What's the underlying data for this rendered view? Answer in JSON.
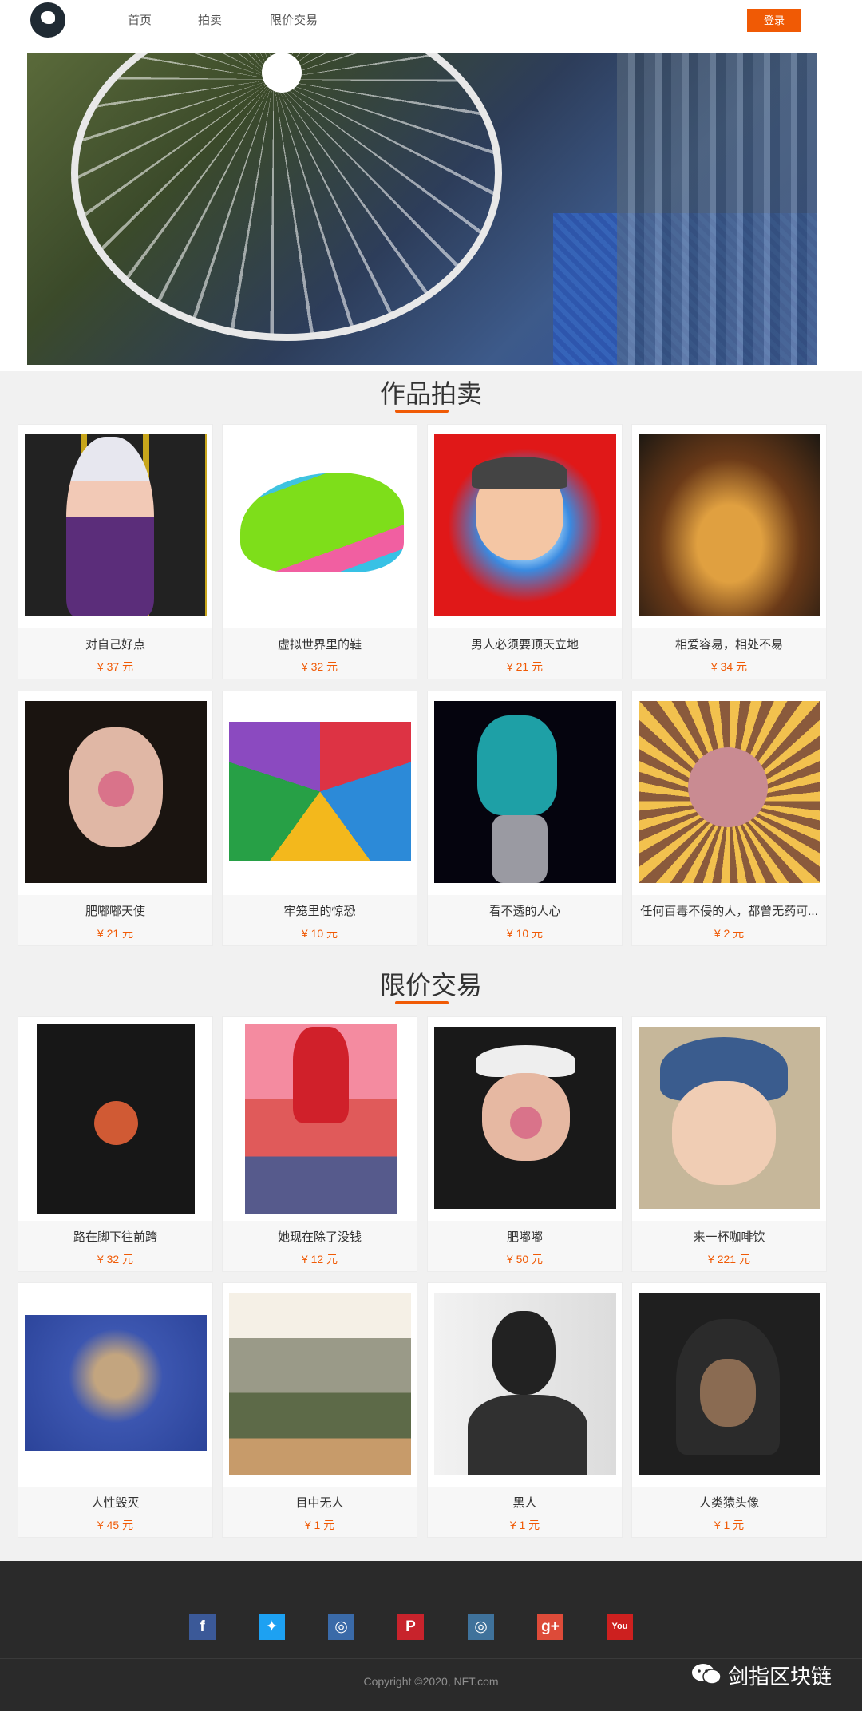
{
  "header": {
    "nav": [
      "首页",
      "拍卖",
      "限价交易"
    ],
    "login_label": "登录"
  },
  "sections": {
    "auction_title": "作品拍卖",
    "fixed_title": "限价交易"
  },
  "auction_items": [
    {
      "title": "对自己好点",
      "price": "¥ 37 元"
    },
    {
      "title": "虚拟世界里的鞋",
      "price": "¥ 32 元"
    },
    {
      "title": "男人必须要顶天立地",
      "price": "¥ 21 元"
    },
    {
      "title": "相爱容易，相处不易",
      "price": "¥ 34 元"
    },
    {
      "title": "肥嘟嘟天使",
      "price": "¥ 21 元"
    },
    {
      "title": "牢笼里的惊恐",
      "price": "¥ 10 元"
    },
    {
      "title": "看不透的人心",
      "price": "¥ 10 元"
    },
    {
      "title": "任何百毒不侵的人，都曾无药可...",
      "price": "¥ 2 元"
    }
  ],
  "fixed_items": [
    {
      "title": "路在脚下往前跨",
      "price": "¥ 32 元"
    },
    {
      "title": "她现在除了没钱",
      "price": "¥ 12 元"
    },
    {
      "title": "肥嘟嘟",
      "price": "¥ 50 元"
    },
    {
      "title": "来一杯咖啡饮",
      "price": "¥ 221 元"
    },
    {
      "title": "人性毁灭",
      "price": "¥ 45 元"
    },
    {
      "title": "目中无人",
      "price": "¥ 1 元"
    },
    {
      "title": "黑人",
      "price": "¥ 1 元"
    },
    {
      "title": "人类猿头像",
      "price": "¥ 1 元"
    }
  ],
  "footer": {
    "social_icons": [
      "facebook-icon",
      "twitter-icon",
      "instagram-icon",
      "pinterest-icon",
      "instagram-icon",
      "google-plus-icon",
      "youtube-icon"
    ],
    "copyright": "Copyright ©2020, NFT.com",
    "watermark": "剑指区块链"
  },
  "colors": {
    "accent": "#f05a05",
    "footer_bg": "#2a2a2a",
    "page_bg": "#f1f1f1"
  }
}
